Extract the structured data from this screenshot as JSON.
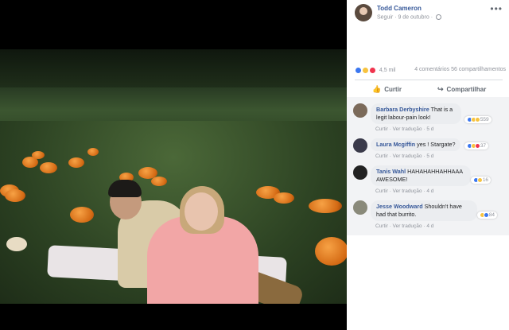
{
  "post": {
    "author": "Todd Cameron",
    "follow": "Seguir",
    "date": "9 de outubro",
    "reactions_count": "4,5 mil",
    "comments_count": "4 comentários",
    "shares_count": "56 compartilhamentos"
  },
  "actions": {
    "like": "Curtir",
    "share": "Compartilhar"
  },
  "comments": [
    {
      "name": "Barbara Derbyshire",
      "text": "That is a legit labour-pain look!",
      "like": "Curtir",
      "translate": "Ver tradução",
      "age": "5 d",
      "react_count": "559"
    },
    {
      "name": "Laura Mcgiffin",
      "text": "yes ! Stargate?",
      "like": "Curtir",
      "translate": "Ver tradução",
      "age": "5 d",
      "react_count": "37"
    },
    {
      "name": "Tanis Wahl",
      "text": "HAHAHAHHAHHAAA AWESOME!",
      "like": "Curtir",
      "translate": "Ver tradução",
      "age": "4 d",
      "react_count": "16"
    },
    {
      "name": "Jesse Woodward",
      "text": "Shouldn't have had that burrito.",
      "like": "Curtir",
      "translate": "Ver tradução",
      "age": "4 d",
      "react_count": "84"
    }
  ],
  "colors": {
    "link": "#365899",
    "meta": "#90949c",
    "bubble": "#ebedf0"
  },
  "icons": [
    "more-icon",
    "globe-icon",
    "like-reaction-icon",
    "haha-reaction-icon",
    "love-reaction-icon",
    "thumbs-up-icon",
    "share-arrow-icon"
  ]
}
